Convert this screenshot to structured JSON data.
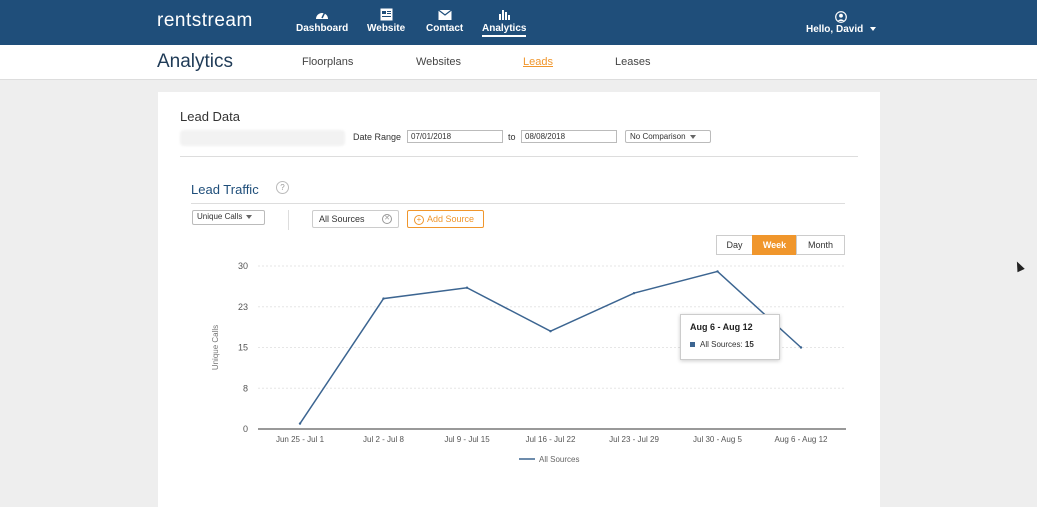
{
  "brand": {
    "logo": "rentstream"
  },
  "topnav": {
    "items": [
      {
        "label": "Dashboard",
        "icon": "dashboard-icon"
      },
      {
        "label": "Website",
        "icon": "website-icon"
      },
      {
        "label": "Contact",
        "icon": "envelope-icon"
      },
      {
        "label": "Analytics",
        "icon": "bar-chart-icon",
        "active": true
      }
    ],
    "user": "Hello, David"
  },
  "subnav": {
    "title": "Analytics",
    "tabs": [
      {
        "label": "Floorplans"
      },
      {
        "label": "Websites"
      },
      {
        "label": "Leads",
        "active": true
      },
      {
        "label": "Leases"
      }
    ]
  },
  "lead_data": {
    "title": "Lead Data",
    "date_range_label": "Date Range",
    "start_date": "07/01/2018",
    "to_label": "to",
    "end_date": "08/08/2018",
    "comparison": "No Comparison"
  },
  "lead_traffic": {
    "title": "Lead Traffic",
    "help": "?",
    "metric": "Unique Calls",
    "source_chip": "All Sources",
    "add_source": "Add Source",
    "granularity": [
      "Day",
      "Week",
      "Month"
    ],
    "granularity_active": "Week"
  },
  "tooltip": {
    "title": "Aug 6 - Aug 12",
    "label": "All Sources:",
    "value": "15"
  },
  "colors": {
    "accent": "#f0962c",
    "nav": "#1f4e7a",
    "series": "#3c6591"
  },
  "chart_data": {
    "type": "line",
    "ylabel": "Unique Calls",
    "xlabel": "",
    "y_ticks": [
      "0",
      "8",
      "15",
      "23",
      "30"
    ],
    "ylim": [
      0,
      30
    ],
    "categories": [
      "Jun 25 - Jul 1",
      "Jul 2 - Jul 8",
      "Jul 9 - Jul 15",
      "Jul 16 - Jul 22",
      "Jul 23 - Jul 29",
      "Jul 30 - Aug 5",
      "Aug 6 - Aug 12"
    ],
    "series": [
      {
        "name": "All Sources",
        "values": [
          1,
          24,
          26,
          18,
          25,
          29,
          15
        ]
      }
    ],
    "legend": "bottom",
    "grid": true
  }
}
